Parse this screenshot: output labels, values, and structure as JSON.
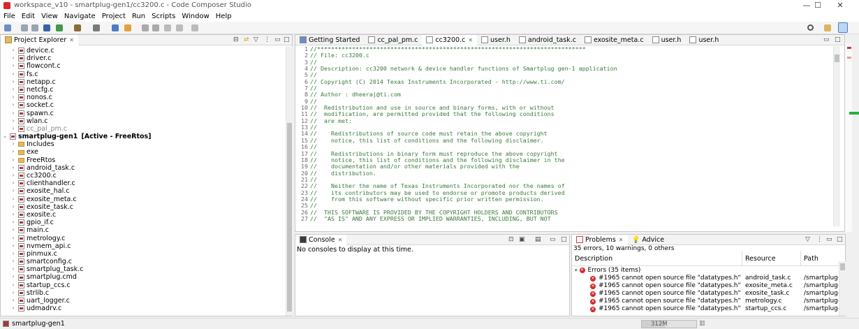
{
  "window": {
    "title": "workspace_v10 - smartplug-gen1/cc3200.c - Code Composer Studio",
    "min": "—",
    "max": "☐",
    "close": "✕"
  },
  "menu": [
    "File",
    "Edit",
    "View",
    "Navigate",
    "Project",
    "Run",
    "Scripts",
    "Window",
    "Help"
  ],
  "explorer": {
    "title": "Project Explorer",
    "top_files": [
      "device.c",
      "driver.c",
      "flowcont.c",
      "fs.c",
      "netapp.c",
      "netcfg.c",
      "nonos.c",
      "socket.c",
      "spawn.c",
      "wlan.c",
      "cc_pal_pm.c"
    ],
    "project_name": "smartplug-gen1",
    "project_status": "[Active - FreeRtos]",
    "folders": [
      "Includes",
      "exe",
      "FreeRtos"
    ],
    "project_files": [
      "android_task.c",
      "cc3200.c",
      "clienthandler.c",
      "exosite_hal.c",
      "exosite_meta.c",
      "exosite_task.c",
      "exosite.c",
      "gpio_if.c",
      "main.c",
      "metrology.c",
      "nvmem_api.c",
      "pinmux.c",
      "smartconfig.c",
      "smartplug_task.c",
      "smartplug.cmd",
      "startup_ccs.c",
      "strlib.c",
      "uart_logger.c",
      "udmadrv.c"
    ]
  },
  "editor": {
    "tabs": [
      "Getting Started",
      "cc_pal_pm.c",
      "cc3200.c",
      "user.h",
      "android_task.c",
      "exosite_meta.c",
      "user.h",
      "user.h"
    ],
    "active_tab": 2,
    "lines": [
      "//*****************************************************************************",
      "// File: cc3200.c",
      "//",
      "// Description: cc3200 network & device handler functions of Smartplug gen-1 application",
      "//",
      "// Copyright (C) 2014 Texas Instruments Incorporated - http://www.ti.com/",
      "//",
      "// Author : dheeraj@ti.com",
      "//",
      "//  Redistribution and use in source and binary forms, with or without",
      "//  modification, are permitted provided that the following conditions",
      "//  are met:",
      "//",
      "//    Redistributions of source code must retain the above copyright",
      "//    notice, this list of conditions and the following disclaimer.",
      "//",
      "//    Redistributions in binary form must reproduce the above copyright",
      "//    notice, this list of conditions and the following disclaimer in the",
      "//    documentation and/or other materials provided with the",
      "//    distribution.",
      "//",
      "//    Neither the name of Texas Instruments Incorporated nor the names of",
      "//    its contributors may be used to endorse or promote products derived",
      "//    from this software without specific prior written permission.",
      "//",
      "//  THIS SOFTWARE IS PROVIDED BY THE COPYRIGHT HOLDERS AND CONTRIBUTORS",
      "//  \"AS IS\" AND ANY EXPRESS OR IMPLIED WARRANTIES, INCLUDING, BUT NOT"
    ]
  },
  "console": {
    "title": "Console",
    "message": "No consoles to display at this time."
  },
  "problems": {
    "title": "Problems",
    "advice_tab": "Advice",
    "summary": "35 errors, 10 warnings, 0 others",
    "columns": [
      "Description",
      "Resource",
      "Path"
    ],
    "group": "Errors (35 items)",
    "rows": [
      {
        "desc": "#1965 cannot open source file \"datatypes.h\"",
        "res": "android_task.c",
        "path": "/smartplug-gen"
      },
      {
        "desc": "#1965 cannot open source file \"datatypes.h\"",
        "res": "exosite_meta.c",
        "path": "/smartplug-gen"
      },
      {
        "desc": "#1965 cannot open source file \"datatypes.h\"",
        "res": "exosite_task.c",
        "path": "/smartplug-gen"
      },
      {
        "desc": "#1965 cannot open source file \"datatypes.h\"",
        "res": "metrology.c",
        "path": "/smartplug-gen"
      },
      {
        "desc": "#1965 cannot open source file \"datatypes.h\"",
        "res": "startup_ccs.c",
        "path": "/smartplug-gen"
      }
    ]
  },
  "status": {
    "project": "smartplug-gen1",
    "heap": "312M"
  }
}
